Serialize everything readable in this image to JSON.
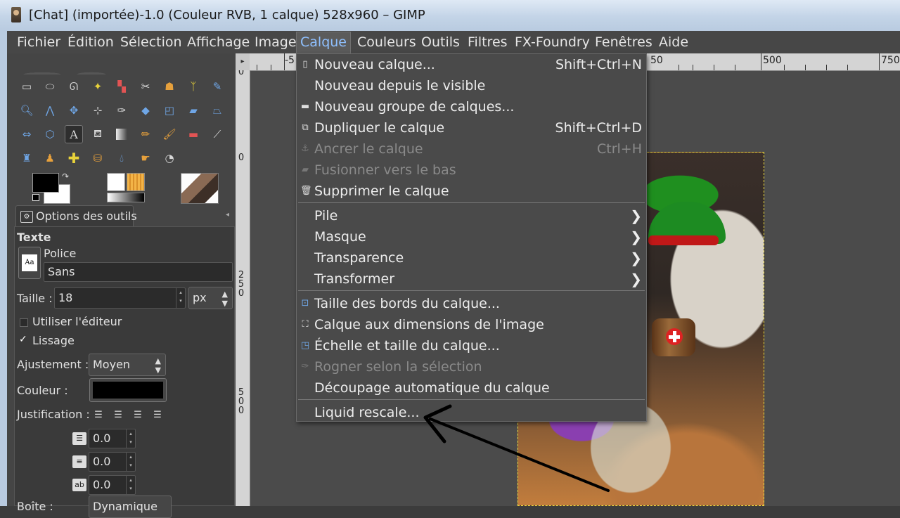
{
  "window": {
    "title": "[Chat] (importée)-1.0 (Couleur RVB, 1 calque) 528x960 – GIMP"
  },
  "menubar": {
    "items": [
      "Fichier",
      "Édition",
      "Sélection",
      "Affichage",
      "Image",
      "Calque",
      "Couleurs",
      "Outils",
      "Filtres",
      "FX-Foundry",
      "Fenêtres",
      "Aide"
    ],
    "active": "Calque"
  },
  "tool_options": {
    "tab_label": "Options des outils",
    "tool_name": "Texte",
    "font_label": "Police",
    "font_value": "Sans",
    "font_button_glyph": "Aa",
    "size_label": "Taille :",
    "size_value": "18",
    "size_unit": "px",
    "use_editor_label": "Utiliser l'éditeur",
    "use_editor_checked": false,
    "antialias_label": "Lissage",
    "antialias_checked": true,
    "hinting_label": "Ajustement :",
    "hinting_value": "Moyen",
    "color_label": "Couleur :",
    "color_value": "#000000",
    "justify_label": "Justification :",
    "indent_value": "0.0",
    "line_spacing_value": "0.0",
    "letter_spacing_value": "0.0",
    "box_label": "Boîte :",
    "box_value": "Dynamique"
  },
  "rulers": {
    "top_labels": [
      "-5",
      "500",
      "750"
    ],
    "partial_top_label": "50",
    "left_labels": [
      "0",
      "0",
      "2\n5\n0",
      "5\n0\n0"
    ]
  },
  "layer_menu": {
    "items": [
      {
        "label": "Nouveau calque...",
        "shortcut": "Shift+Ctrl+N",
        "icon": "new-layer-icon",
        "enabled": true
      },
      {
        "label": "Nouveau depuis le visible",
        "shortcut": "",
        "icon": "",
        "enabled": true
      },
      {
        "label": "Nouveau groupe de calques...",
        "shortcut": "",
        "icon": "folder-icon",
        "enabled": true
      },
      {
        "label": "Dupliquer le calque",
        "shortcut": "Shift+Ctrl+D",
        "icon": "duplicate-icon",
        "enabled": true
      },
      {
        "label": "Ancrer le calque",
        "shortcut": "Ctrl+H",
        "icon": "anchor-icon",
        "enabled": false
      },
      {
        "label": "Fusionner vers le bas",
        "shortcut": "",
        "icon": "merge-icon",
        "enabled": false
      },
      {
        "label": "Supprimer le calque",
        "shortcut": "",
        "icon": "trash-icon",
        "enabled": true
      },
      {
        "label": "Pile",
        "submenu": true,
        "enabled": true
      },
      {
        "label": "Masque",
        "submenu": true,
        "enabled": true
      },
      {
        "label": "Transparence",
        "submenu": true,
        "enabled": true
      },
      {
        "label": "Transformer",
        "submenu": true,
        "enabled": true
      },
      {
        "label": "Taille des bords du calque...",
        "icon": "layer-size-icon",
        "enabled": true
      },
      {
        "label": "Calque aux dimensions de l'image",
        "icon": "fit-image-icon",
        "enabled": true
      },
      {
        "label": "Échelle et taille du calque...",
        "icon": "scale-icon",
        "enabled": true
      },
      {
        "label": "Rogner selon la sélection",
        "icon": "crop-icon",
        "enabled": false
      },
      {
        "label": "Découpage automatique du calque",
        "icon": "",
        "enabled": true
      },
      {
        "label": "Liquid rescale...",
        "icon": "",
        "enabled": true
      }
    ]
  },
  "colors": {
    "menu_active_text": "#8fc0ff",
    "selection_border": "#f0e040",
    "annotation_arrow": "#000000"
  }
}
